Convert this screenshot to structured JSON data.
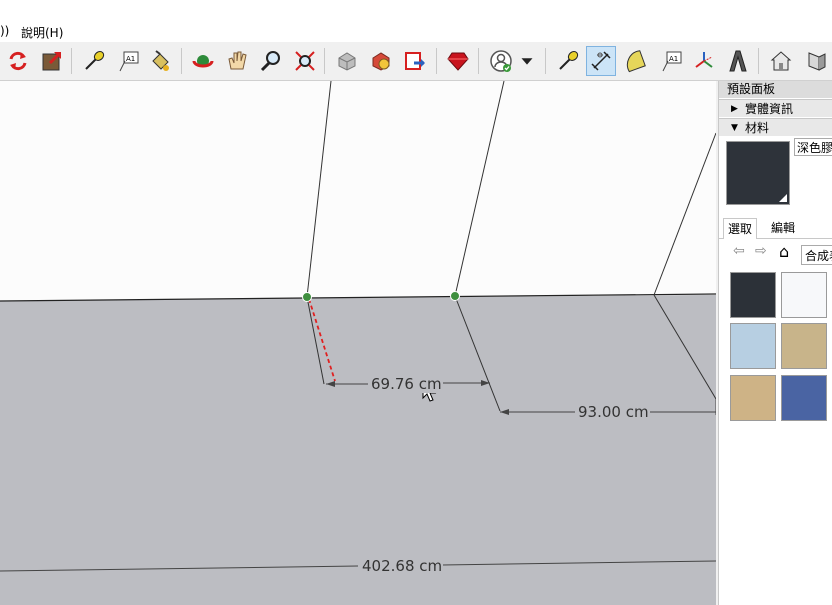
{
  "menubar": {
    "items": [
      "))",
      "說明(H)"
    ]
  },
  "toolbar": {
    "icons": [
      "refresh-icon",
      "export-icon",
      "tape-measure-icon",
      "text-label-icon",
      "paint-bucket-icon",
      "orbit-icon",
      "pan-icon",
      "zoom-icon",
      "zoom-extents-icon",
      "warehouse-icon",
      "extension-warehouse-icon",
      "layout-send-icon",
      "ruby-icon",
      "account-icon",
      "tape-measure-icon",
      "dimension-icon",
      "protractor-icon",
      "text-icon",
      "axes-icon",
      "3d-text-icon",
      "house-icon",
      "section-icon"
    ]
  },
  "viewport": {
    "dimensions": [
      "69.76 cm",
      "93.00 cm",
      "402.68 cm"
    ],
    "colors": {
      "wall": "#fcfcfc",
      "floor": "#bcbdc2",
      "inference_point": "#3f8f3f",
      "inference_line": "#e02020"
    }
  },
  "panel": {
    "title": "預設面板",
    "entity_info_label": "實體資訊",
    "materials_label": "材料",
    "material_name": "深色膠",
    "tabs": {
      "select": "選取",
      "edit": "編輯"
    },
    "library_value": "合成表",
    "swatch_colors": [
      "#2c3138",
      "#f7f8fa",
      "#b7cfe2",
      "#c8b48a",
      "#ceb386",
      "#4a64a3"
    ],
    "current_material_color": "#2e333a"
  }
}
